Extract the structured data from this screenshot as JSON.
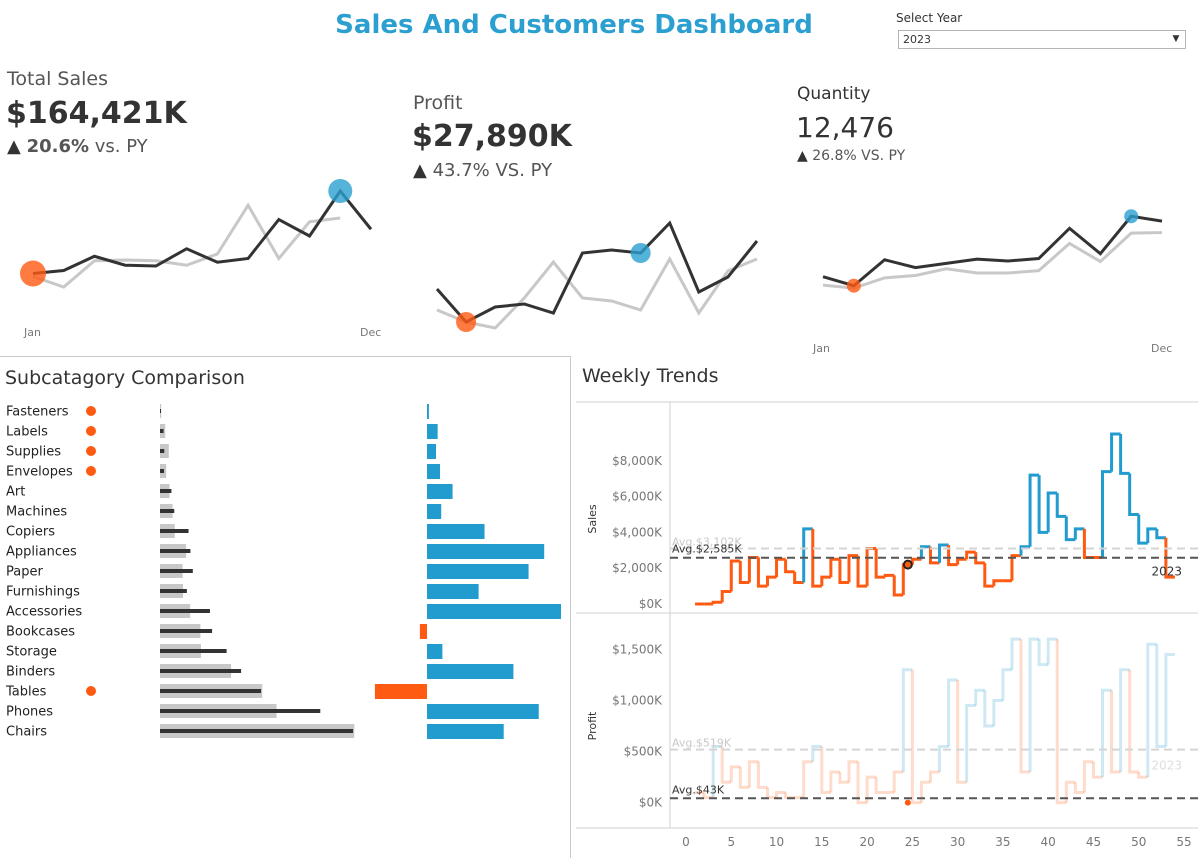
{
  "title": "Sales And Customers Dashboard",
  "filter": {
    "label": "Select Year",
    "value": "2023",
    "icon": "chevron-down-icon"
  },
  "colors": {
    "accent": "#2a9fd0",
    "negative": "#fc5a10",
    "current": "#333333",
    "prior": "#c8c8c8",
    "barBlue": "#229ccf",
    "barOrange": "#ff5a12"
  },
  "kpis": [
    {
      "title": "Total Sales",
      "value": "$164,421K",
      "arrow": "▲",
      "change": "20.6%",
      "suffix": " vs. PY",
      "axis_start": "Jan",
      "axis_end": "Dec",
      "current": [
        6.2,
        6.6,
        8.5,
        7.3,
        7.2,
        9.5,
        7.7,
        8.2,
        13.4,
        11.2,
        17.2,
        12.1
      ],
      "prior": [
        5.8,
        4.4,
        7.9,
        8.0,
        7.9,
        7.3,
        8.8,
        15.3,
        8.2,
        13.1,
        13.6,
        null
      ],
      "min_month": 1,
      "max_month": 11,
      "ymin": 0,
      "ymax": 20
    },
    {
      "title": "Profit",
      "value": "$27,890K",
      "arrow": "▲",
      "change": "43.7%",
      "suffix": " VS. PY",
      "current": [
        1.7,
        0.6,
        1.1,
        1.2,
        0.9,
        2.9,
        3.0,
        2.9,
        3.9,
        1.6,
        2.1,
        3.3
      ],
      "prior": [
        1.0,
        0.6,
        0.4,
        1.4,
        2.6,
        1.4,
        1.3,
        1.0,
        2.7,
        0.9,
        2.3,
        2.7
      ],
      "min_month": 2,
      "max_month": 8,
      "ymin": 0,
      "ymax": 5
    },
    {
      "title": "Quantity",
      "value": "12,476",
      "arrow": "▲",
      "change": "26.8%",
      "suffix": " VS. PY",
      "axis_start": "Jan",
      "axis_end": "Dec",
      "current": [
        800,
        650,
        1080,
        950,
        1020,
        1090,
        1060,
        1100,
        1600,
        1180,
        1800,
        1720
      ],
      "prior": [
        660,
        610,
        780,
        820,
        930,
        860,
        860,
        900,
        1350,
        1050,
        1520,
        1530
      ],
      "min_month": 2,
      "max_month": 11,
      "ymin": 0,
      "ymax": 2400
    }
  ],
  "subcategory": {
    "title": "Subcatagory Comparison",
    "rows": [
      {
        "name": "Fasteners",
        "flag": true,
        "prior": 0.5,
        "current": 0.4,
        "profit": 0.8
      },
      {
        "name": "Labels",
        "flag": true,
        "prior": 2.2,
        "current": 1.5,
        "profit": 4.5
      },
      {
        "name": "Supplies",
        "flag": true,
        "prior": 3.7,
        "current": 1.8,
        "profit": 3.8
      },
      {
        "name": "Envelopes",
        "flag": true,
        "prior": 2.6,
        "current": 1.7,
        "profit": 5.5
      },
      {
        "name": "Art",
        "flag": false,
        "prior": 4.0,
        "current": 4.8,
        "profit": 10.8
      },
      {
        "name": "Machines",
        "flag": false,
        "prior": 5.3,
        "current": 6.0,
        "profit": 6.0
      },
      {
        "name": "Copiers",
        "flag": false,
        "prior": 6.2,
        "current": 12.0,
        "profit": 24.3
      },
      {
        "name": "Appliances",
        "flag": false,
        "prior": 11.0,
        "current": 12.8,
        "profit": 49.5
      },
      {
        "name": "Paper",
        "flag": false,
        "prior": 9.5,
        "current": 13.8,
        "profit": 42.9
      },
      {
        "name": "Furnishings",
        "flag": false,
        "prior": 9.7,
        "current": 11.3,
        "profit": 21.8
      },
      {
        "name": "Accessories",
        "flag": false,
        "prior": 12.7,
        "current": 21.0,
        "profit": 56.6
      },
      {
        "name": "Bookcases",
        "flag": false,
        "prior": 17.0,
        "current": 21.9,
        "profit": -3.0
      },
      {
        "name": "Storage",
        "flag": false,
        "prior": 17.2,
        "current": 28.0,
        "profit": 6.5
      },
      {
        "name": "Binders",
        "flag": false,
        "prior": 29.9,
        "current": 34.1,
        "profit": 36.5
      },
      {
        "name": "Tables",
        "flag": true,
        "prior": 43.0,
        "current": 42.5,
        "profit": -22.0
      },
      {
        "name": "Phones",
        "flag": false,
        "prior": 49.0,
        "current": 67.4,
        "profit": 47.2
      },
      {
        "name": "Chairs",
        "flag": false,
        "prior": 81.7,
        "current": 81.2,
        "profit": 32.4
      }
    ]
  },
  "weekly": {
    "title": "Weekly Trends",
    "xticks": [
      "0",
      "5",
      "10",
      "15",
      "20",
      "25",
      "30",
      "35",
      "40",
      "45",
      "50",
      "55"
    ],
    "sales": {
      "ylabel": "Sales",
      "ticks": [
        "$0K",
        "$2,000K",
        "$4,000K",
        "$6,000K",
        "$8,000K"
      ],
      "ymax": 9500,
      "avg_label": "Avg.$2,585K",
      "avg": 2585,
      "prior_avg_label": "Avg.$3,102K",
      "prior_avg": 3102,
      "year_label": "2023",
      "values": [
        0,
        0,
        100,
        700,
        2400,
        1200,
        2600,
        1000,
        1500,
        2500,
        1800,
        1200,
        4200,
        1000,
        1500,
        2500,
        1200,
        2700,
        1000,
        3100,
        1500,
        1600,
        500,
        2200,
        2500,
        3200,
        2300,
        3300,
        2200,
        2500,
        2900,
        2300,
        1000,
        1300,
        1300,
        2700,
        3200,
        7200,
        4000,
        6200,
        4900,
        3600,
        4200,
        2600,
        2600,
        7400,
        9500,
        7300,
        5000,
        3400,
        4200,
        3700,
        1500
      ],
      "marker_week": 24
    },
    "profit": {
      "ylabel": "Profit",
      "ticks": [
        "$0K",
        "$500K",
        "$1,000K",
        "$1,500K"
      ],
      "ymin": -150,
      "ymax": 1650,
      "avg_label": "Avg.$43K",
      "avg": 43,
      "prior_avg_label": "Avg.$519K",
      "prior_avg": 519,
      "year_label": "2023",
      "values": [
        100,
        50,
        550,
        200,
        350,
        150,
        400,
        150,
        50,
        100,
        50,
        50,
        400,
        550,
        100,
        300,
        200,
        400,
        0,
        250,
        100,
        100,
        300,
        1300,
        0,
        200,
        300,
        550,
        1200,
        200,
        950,
        1100,
        750,
        1000,
        1300,
        1600,
        300,
        1600,
        1350,
        1600,
        0,
        200,
        100,
        400,
        250,
        1100,
        300,
        1300,
        300,
        250,
        1550,
        550,
        1450
      ],
      "marker_week": 24
    }
  }
}
